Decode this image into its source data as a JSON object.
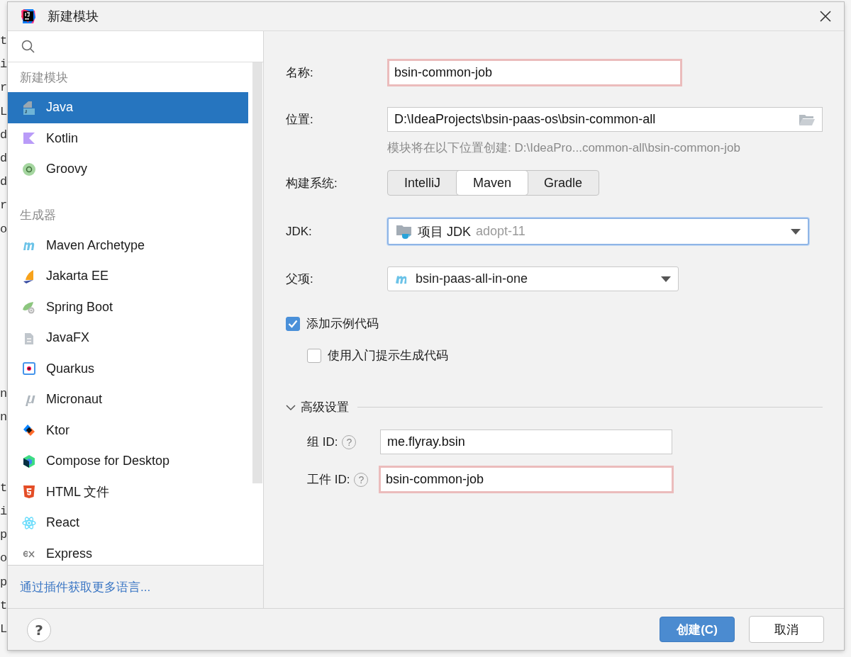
{
  "window": {
    "title": "新建模块"
  },
  "editor_fragments": [
    [
      "t",
      "i",
      "r",
      "L",
      "d",
      "d",
      "d",
      "r",
      "o"
    ],
    [
      "n",
      "n"
    ],
    [
      "t",
      "i",
      "p",
      "o",
      "p",
      "t",
      "L"
    ]
  ],
  "sidebar": {
    "groups": [
      {
        "heading": "新建模块",
        "items": [
          {
            "label": "Java",
            "kind": "java",
            "selected": true
          },
          {
            "label": "Kotlin",
            "kind": "kotlin",
            "selected": false
          },
          {
            "label": "Groovy",
            "kind": "groovy",
            "selected": false
          }
        ]
      },
      {
        "heading": "生成器",
        "items": [
          {
            "label": "Maven Archetype",
            "kind": "maven",
            "selected": false
          },
          {
            "label": "Jakarta EE",
            "kind": "jakarta",
            "selected": false
          },
          {
            "label": "Spring Boot",
            "kind": "spring",
            "selected": false
          },
          {
            "label": "JavaFX",
            "kind": "javafx",
            "selected": false
          },
          {
            "label": "Quarkus",
            "kind": "quarkus",
            "selected": false
          },
          {
            "label": "Micronaut",
            "kind": "micronaut",
            "selected": false
          },
          {
            "label": "Ktor",
            "kind": "ktor",
            "selected": false
          },
          {
            "label": "Compose for Desktop",
            "kind": "compose",
            "selected": false
          },
          {
            "label": "HTML 文件",
            "kind": "html",
            "selected": false
          },
          {
            "label": "React",
            "kind": "react",
            "selected": false
          },
          {
            "label": "Express",
            "kind": "express",
            "selected": false
          }
        ]
      }
    ],
    "footer_link": "通过插件获取更多语言..."
  },
  "form": {
    "name": {
      "label": "名称:",
      "value": "bsin-common-job",
      "error": true
    },
    "location": {
      "label": "位置:",
      "value": "D:\\IdeaProjects\\bsin-paas-os\\bsin-common-all",
      "hint": "模块将在以下位置创建: D:\\IdeaPro...common-all\\bsin-common-job"
    },
    "build_system": {
      "label": "构建系统:",
      "options": [
        {
          "label": "IntelliJ",
          "selected": false
        },
        {
          "label": "Maven",
          "selected": true
        },
        {
          "label": "Gradle",
          "selected": false
        }
      ]
    },
    "jdk": {
      "label": "JDK:",
      "value": "项目 JDK",
      "detail": "adopt-11",
      "focused": true
    },
    "parent": {
      "label": "父项:",
      "value": "bsin-paas-all-in-one"
    },
    "checkboxes": [
      {
        "label": "添加示例代码",
        "checked": true,
        "children": [
          {
            "label": "使用入门提示生成代码",
            "checked": false
          }
        ]
      }
    ],
    "advanced": {
      "title": "高级设置",
      "expanded": true,
      "fields": [
        {
          "label": "组 ID:",
          "help": "?",
          "value": "me.flyray.bsin",
          "error": false
        },
        {
          "label": "工件 ID:",
          "help": "?",
          "value": "bsin-common-job",
          "error": true
        }
      ]
    }
  },
  "help_button": "?",
  "buttons": [
    {
      "label": "创建(C)",
      "kind": "primary"
    },
    {
      "label": "取消",
      "kind": "secondary"
    }
  ]
}
